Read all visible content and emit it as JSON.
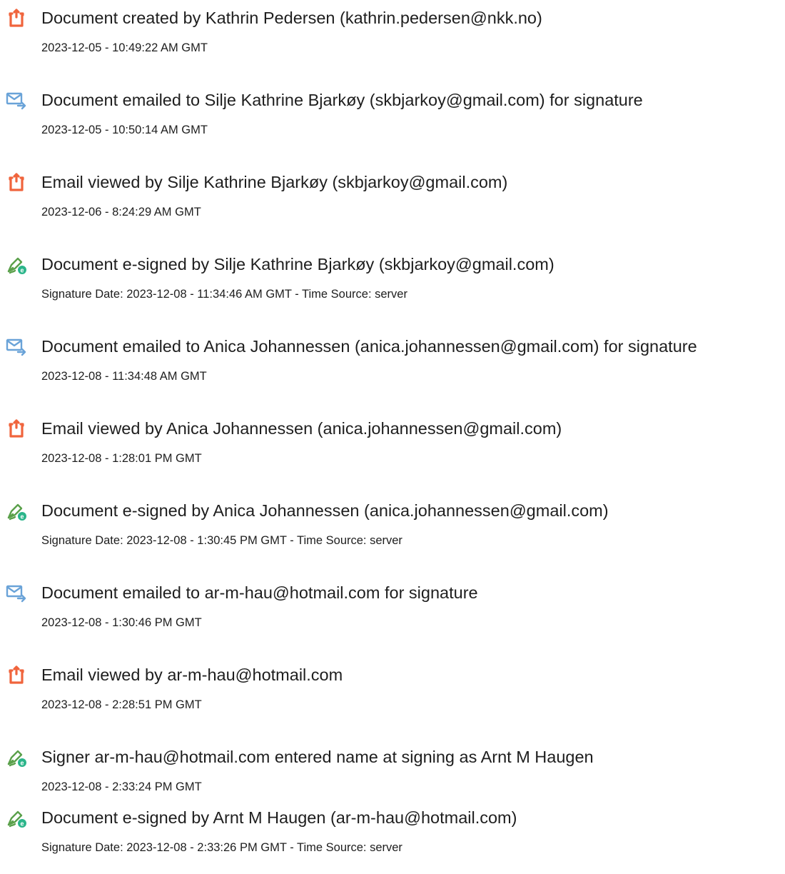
{
  "events": [
    {
      "icon": "document-created-icon",
      "title": "Document created by Kathrin Pedersen (kathrin.pedersen@nkk.no)",
      "detail": "2023-12-05 - 10:49:22 AM GMT"
    },
    {
      "icon": "email-sent-icon",
      "title": "Document emailed to Silje Kathrine Bjarkøy (skbjarkoy@gmail.com) for signature",
      "detail": "2023-12-05 - 10:50:14 AM GMT"
    },
    {
      "icon": "document-viewed-icon",
      "title": "Email viewed by Silje Kathrine Bjarkøy (skbjarkoy@gmail.com)",
      "detail": "2023-12-06 - 8:24:29 AM GMT"
    },
    {
      "icon": "e-sign-pen-icon",
      "title": "Document e-signed by Silje Kathrine Bjarkøy (skbjarkoy@gmail.com)",
      "detail": "Signature Date: 2023-12-08 - 11:34:46 AM GMT - Time Source: server"
    },
    {
      "icon": "email-sent-icon",
      "title": "Document emailed to Anica Johannessen (anica.johannessen@gmail.com) for signature",
      "detail": "2023-12-08 - 11:34:48 AM GMT"
    },
    {
      "icon": "document-viewed-icon",
      "title": "Email viewed by Anica Johannessen (anica.johannessen@gmail.com)",
      "detail": "2023-12-08 - 1:28:01 PM GMT"
    },
    {
      "icon": "e-sign-pen-icon",
      "title": "Document e-signed by Anica Johannessen (anica.johannessen@gmail.com)",
      "detail": "Signature Date: 2023-12-08 - 1:30:45 PM GMT - Time Source: server"
    },
    {
      "icon": "email-sent-icon",
      "title": "Document emailed to ar-m-hau@hotmail.com for signature",
      "detail": "2023-12-08 - 1:30:46 PM GMT"
    },
    {
      "icon": "document-viewed-icon",
      "title": "Email viewed by ar-m-hau@hotmail.com",
      "detail": "2023-12-08 - 2:28:51 PM GMT"
    },
    {
      "icon": "e-sign-pen-icon",
      "title": "Signer ar-m-hau@hotmail.com entered name at signing as Arnt M Haugen",
      "detail": "2023-12-08 - 2:33:24 PM GMT"
    },
    {
      "icon": "e-sign-pen-icon",
      "title": "Document e-signed by Arnt M Haugen (ar-m-hau@hotmail.com)",
      "detail": "Signature Date: 2023-12-08 - 2:33:26 PM GMT - Time Source: server"
    }
  ],
  "colors": {
    "document_icon": "#f0643c",
    "email_icon": "#6aa3d8",
    "pen_icon": "#5aa04a",
    "e_badge": "#2bb58a"
  }
}
